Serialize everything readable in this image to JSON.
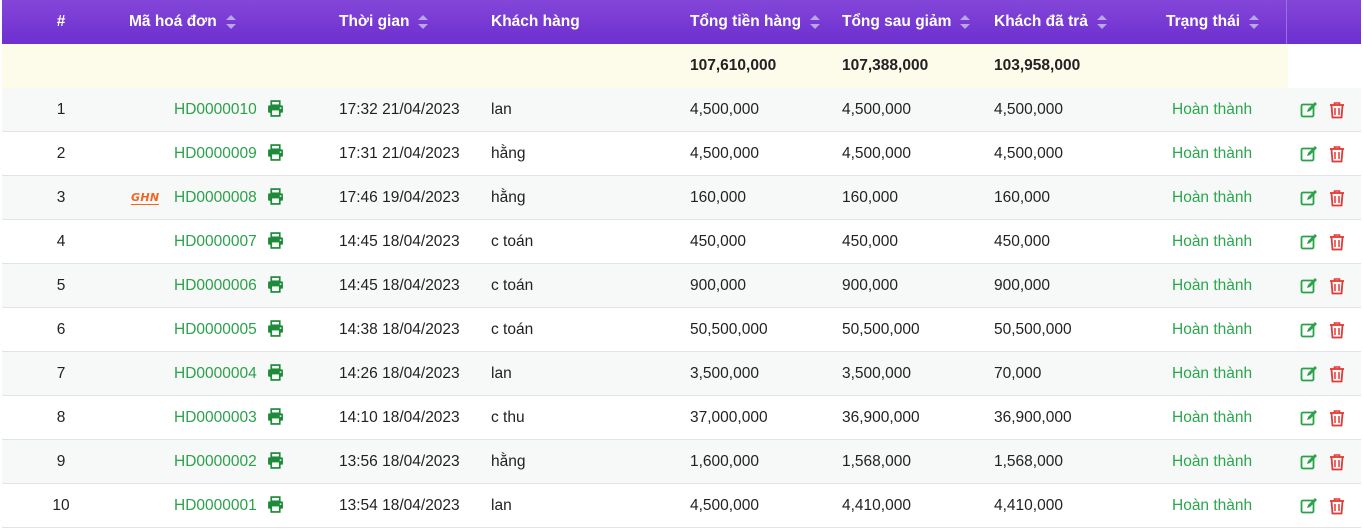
{
  "columns": {
    "index": "#",
    "invoice_code": "Mã hoá đơn",
    "time": "Thời gian",
    "customer": "Khách hàng",
    "subtotal": "Tổng tiền hàng",
    "after_discount": "Tổng sau giảm",
    "paid": "Khách đã trả",
    "status": "Trạng thái"
  },
  "totals": {
    "subtotal": "107,610,000",
    "after_discount": "107,388,000",
    "paid": "103,958,000"
  },
  "rows": [
    {
      "index": "1",
      "code": "HD0000010",
      "time": "17:32 21/04/2023",
      "customer": "lan",
      "subtotal": "4,500,000",
      "after_discount": "4,500,000",
      "paid": "4,500,000",
      "status": "Hoàn thành",
      "carrier": ""
    },
    {
      "index": "2",
      "code": "HD0000009",
      "time": "17:31 21/04/2023",
      "customer": "hằng",
      "subtotal": "4,500,000",
      "after_discount": "4,500,000",
      "paid": "4,500,000",
      "status": "Hoàn thành",
      "carrier": ""
    },
    {
      "index": "3",
      "code": "HD0000008",
      "time": "17:46 19/04/2023",
      "customer": "hằng",
      "subtotal": "160,000",
      "after_discount": "160,000",
      "paid": "160,000",
      "status": "Hoàn thành",
      "carrier": "GHN"
    },
    {
      "index": "4",
      "code": "HD0000007",
      "time": "14:45 18/04/2023",
      "customer": "c toán",
      "subtotal": "450,000",
      "after_discount": "450,000",
      "paid": "450,000",
      "status": "Hoàn thành",
      "carrier": ""
    },
    {
      "index": "5",
      "code": "HD0000006",
      "time": "14:45 18/04/2023",
      "customer": "c toán",
      "subtotal": "900,000",
      "after_discount": "900,000",
      "paid": "900,000",
      "status": "Hoàn thành",
      "carrier": ""
    },
    {
      "index": "6",
      "code": "HD0000005",
      "time": "14:38 18/04/2023",
      "customer": "c toán",
      "subtotal": "50,500,000",
      "after_discount": "50,500,000",
      "paid": "50,500,000",
      "status": "Hoàn thành",
      "carrier": ""
    },
    {
      "index": "7",
      "code": "HD0000004",
      "time": "14:26 18/04/2023",
      "customer": "lan",
      "subtotal": "3,500,000",
      "after_discount": "3,500,000",
      "paid": "70,000",
      "status": "Hoàn thành",
      "carrier": ""
    },
    {
      "index": "8",
      "code": "HD0000003",
      "time": "14:10 18/04/2023",
      "customer": "c thu",
      "subtotal": "37,000,000",
      "after_discount": "36,900,000",
      "paid": "36,900,000",
      "status": "Hoàn thành",
      "carrier": ""
    },
    {
      "index": "9",
      "code": "HD0000002",
      "time": "13:56 18/04/2023",
      "customer": "hằng",
      "subtotal": "1,600,000",
      "after_discount": "1,568,000",
      "paid": "1,568,000",
      "status": "Hoàn thành",
      "carrier": ""
    },
    {
      "index": "10",
      "code": "HD0000001",
      "time": "13:54 18/04/2023",
      "customer": "lan",
      "subtotal": "4,500,000",
      "after_discount": "4,410,000",
      "paid": "4,410,000",
      "status": "Hoàn thành",
      "carrier": ""
    }
  ],
  "icons": {
    "sort": "sort-icon",
    "print": "printer-icon",
    "edit": "edit-icon",
    "delete": "trash-icon",
    "carrier_logo": "ghn-logo"
  },
  "colors": {
    "header_bg": "#7a3ad6",
    "link_green": "#2aa24a",
    "status_green": "#29a74d",
    "delete_red": "#e53935",
    "totals_bg": "#fdfbea"
  }
}
